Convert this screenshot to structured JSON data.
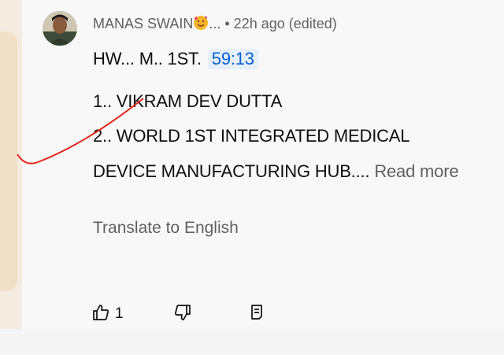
{
  "comment": {
    "author": "MANAS SWAIN",
    "author_suffix": "...",
    "time": " • 22h ago (edited)",
    "line1_text": "HW... M.. 1ST.",
    "line1_timestamp": "59:13",
    "line2": "1.. VIKRAM DEV DUTTA",
    "line3": "2.. WORLD 1ST INTEGRATED MEDICAL",
    "line4_text": "DEVICE MANUFACTURING HUB....",
    "read_more": "Read more",
    "translate": "Translate to English",
    "like_count": "1"
  },
  "icons": {
    "avatar": "avatar",
    "emoji": "smiling-face-with-hearts-icon",
    "like": "thumbs-up-icon",
    "dislike": "thumbs-down-icon",
    "reply": "reply-icon"
  },
  "colors": {
    "timestamp_link": "#065fd4",
    "annotation": "#e0261b"
  }
}
